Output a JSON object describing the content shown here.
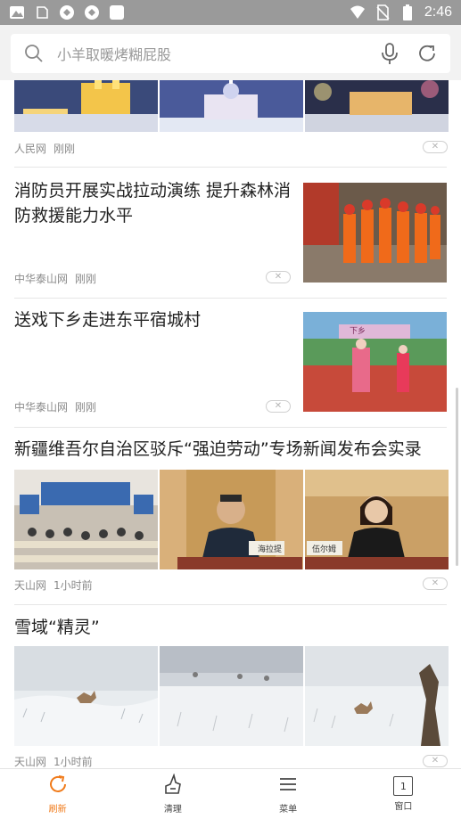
{
  "status_bar": {
    "time": "2:46",
    "icons": [
      "app-icon",
      "outline-icon",
      "network-icon",
      "network-icon",
      "square-icon",
      "wifi-icon",
      "no-sim-icon",
      "battery-icon"
    ]
  },
  "search": {
    "placeholder": "小羊取暖烤糊屁股"
  },
  "feed": {
    "items": [
      {
        "source": "人民网",
        "time": "刚刚"
      },
      {
        "title_line1": "消防员开展实战拉动演练 提升森林消",
        "title_line2": "防救援能力水平",
        "source": "中华泰山网",
        "time": "刚刚"
      },
      {
        "title": "送戏下乡走进东平宿城村",
        "source": "中华泰山网",
        "time": "刚刚",
        "banner_text": "下乡"
      },
      {
        "title": "新疆维吾尔自治区驳斥“强迫劳动”专场新闻发布会实录",
        "source": "天山网",
        "time": "1小时前",
        "name_plate_1": "海拉提",
        "name_plate_2": "伍尔姆"
      },
      {
        "title": "雪域“精灵”",
        "source": "天山网",
        "time": "1小时前"
      }
    ]
  },
  "bottom_bar": {
    "tabs": [
      {
        "label": "刷新",
        "icon": "refresh-icon",
        "active": true
      },
      {
        "label": "清理",
        "icon": "broom-icon",
        "active": false
      },
      {
        "label": "菜单",
        "icon": "menu-icon",
        "active": false
      },
      {
        "label": "窗口",
        "icon": "window-icon",
        "active": false,
        "count": "1"
      }
    ]
  },
  "colors": {
    "accent": "#f07a19",
    "status_bar_bg": "#9a9a9a",
    "search_bg": "#f2f2f2"
  }
}
